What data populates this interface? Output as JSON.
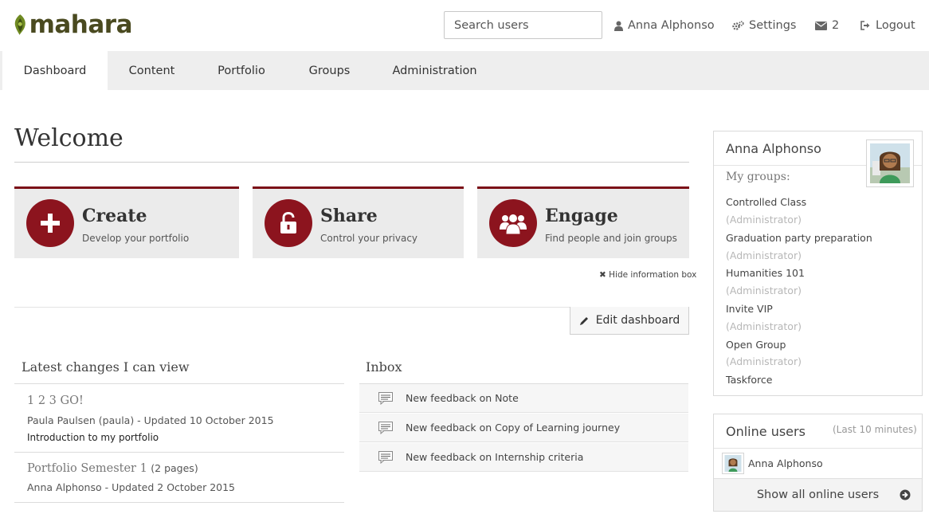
{
  "header": {
    "logo_text": "mahara",
    "search_placeholder": "Search users",
    "user_name": "Anna Alphonso",
    "settings_label": "Settings",
    "inbox_count": "2",
    "logout_label": "Logout"
  },
  "nav": {
    "tabs": [
      {
        "label": "Dashboard",
        "active": true
      },
      {
        "label": "Content"
      },
      {
        "label": "Portfolio"
      },
      {
        "label": "Groups"
      },
      {
        "label": "Administration"
      }
    ]
  },
  "main": {
    "title": "Welcome",
    "cards": [
      {
        "title": "Create",
        "subtitle": "Develop your portfolio",
        "icon": "plus-icon"
      },
      {
        "title": "Share",
        "subtitle": "Control your privacy",
        "icon": "unlock-icon"
      },
      {
        "title": "Engage",
        "subtitle": "Find people and join groups",
        "icon": "users-icon"
      }
    ],
    "hide_info_label": "Hide information box",
    "edit_dashboard_label": "Edit dashboard"
  },
  "latest_changes": {
    "title": "Latest changes I can view",
    "items": [
      {
        "title": "1 2 3 GO!",
        "meta": "Paula Paulsen (paula) - Updated 10 October 2015",
        "description": "Introduction to my portfolio"
      },
      {
        "title": "Portfolio Semester 1",
        "pages": "(2 pages)",
        "meta": "Anna Alphonso - Updated 2 October 2015"
      }
    ]
  },
  "inbox": {
    "title": "Inbox",
    "items": [
      "New feedback on Note",
      "New feedback on Copy of Learning journey",
      "New feedback on Internship criteria"
    ]
  },
  "profile": {
    "name": "Anna Alphonso",
    "my_groups_label": "My groups:",
    "groups": [
      {
        "name": "Controlled Class",
        "role": "(Administrator)"
      },
      {
        "name": "Graduation party preparation",
        "role": "(Administrator)"
      },
      {
        "name": "Humanities 101",
        "role": "(Administrator)"
      },
      {
        "name": "Invite VIP",
        "role": "(Administrator)"
      },
      {
        "name": "Open Group",
        "role": "(Administrator)"
      },
      {
        "name": "Taskforce",
        "role": ""
      }
    ]
  },
  "online_users": {
    "title": "Online users",
    "period": "(Last 10 minutes)",
    "users": [
      "Anna Alphonso"
    ],
    "show_all_label": "Show all online users"
  },
  "colors": {
    "accent": "#8c141e",
    "nav_bg": "#eeeeee",
    "card_bg": "#ebebeb"
  }
}
